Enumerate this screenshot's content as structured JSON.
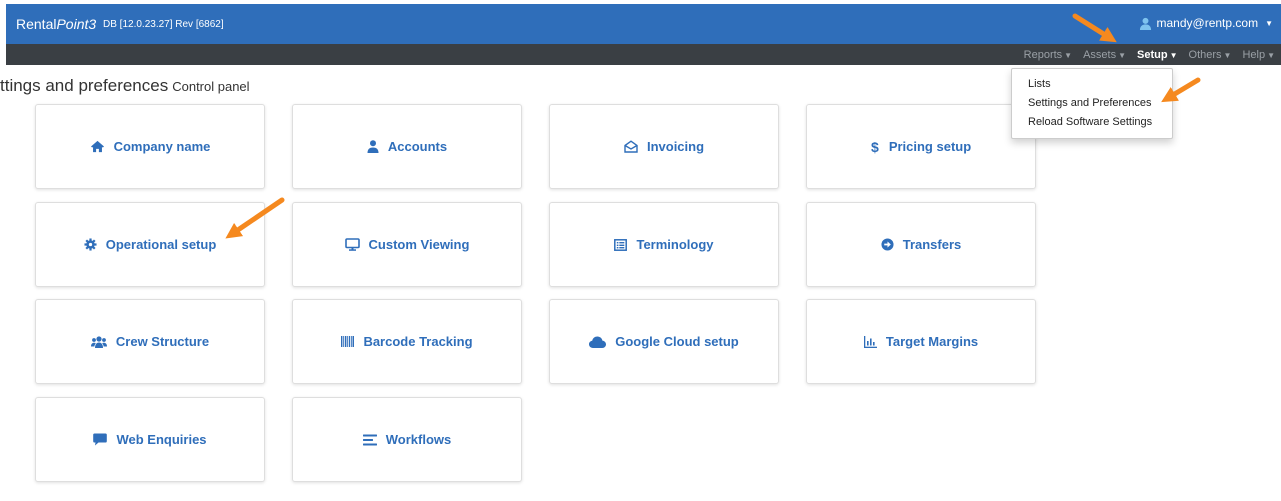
{
  "header": {
    "brand_plain": "Rental",
    "brand_italic": "Point3",
    "db_info": "DB [12.0.23.27]  Rev [6862]",
    "user": "mandy@rentp.com"
  },
  "nav": {
    "items": [
      {
        "label": "Reports"
      },
      {
        "label": "Assets"
      },
      {
        "label": "Setup"
      },
      {
        "label": "Others"
      },
      {
        "label": "Help"
      }
    ]
  },
  "page": {
    "title": "ttings and preferences",
    "subtitle": "Control panel"
  },
  "setup_menu": {
    "items": [
      "Lists",
      "Settings and Preferences",
      "Reload Software Settings"
    ]
  },
  "tiles": [
    {
      "label": "Company name",
      "icon": "home-icon"
    },
    {
      "label": "Accounts",
      "icon": "user-icon"
    },
    {
      "label": "Invoicing",
      "icon": "envelope-open-icon"
    },
    {
      "label": "Pricing setup",
      "icon": "dollar-icon"
    },
    {
      "label": "Operational setup",
      "icon": "gear-icon"
    },
    {
      "label": "Custom Viewing",
      "icon": "monitor-icon"
    },
    {
      "label": "Terminology",
      "icon": "list-icon"
    },
    {
      "label": "Transfers",
      "icon": "arrow-circle-right-icon"
    },
    {
      "label": "Crew Structure",
      "icon": "users-icon"
    },
    {
      "label": "Barcode Tracking",
      "icon": "barcode-icon"
    },
    {
      "label": "Google Cloud setup",
      "icon": "cloud-icon"
    },
    {
      "label": "Target Margins",
      "icon": "chart-icon"
    },
    {
      "label": "Web Enquiries",
      "icon": "comment-icon"
    },
    {
      "label": "Workflows",
      "icon": "bars-icon"
    }
  ],
  "colors": {
    "header_bg": "#2f6eba",
    "navbar_bg": "#3a3f44",
    "tile_text": "#2f6eba",
    "annotation_arrow": "#f5891f"
  }
}
